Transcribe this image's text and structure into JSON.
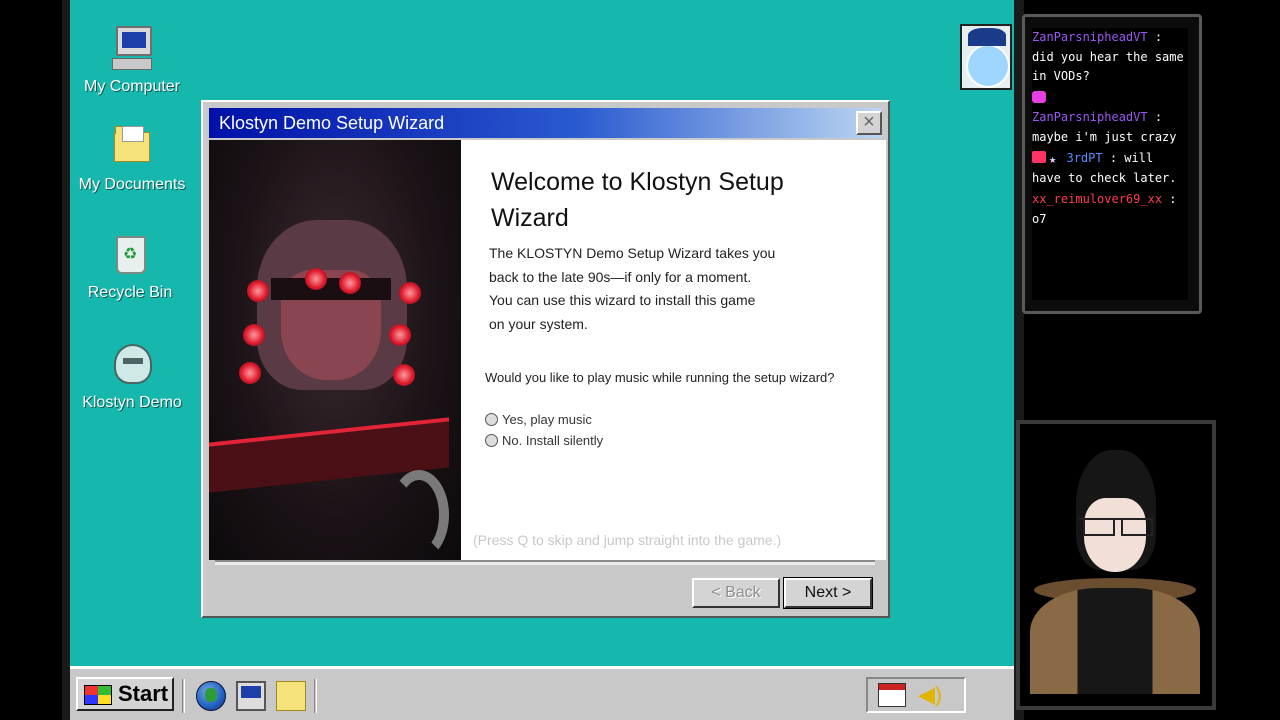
{
  "desktop": {
    "icons": [
      {
        "label": "My Computer"
      },
      {
        "label": "My Documents"
      },
      {
        "label": "Recycle Bin"
      },
      {
        "label": "Klostyn Demo"
      }
    ]
  },
  "wizard": {
    "title": "Klostyn Demo Setup Wizard",
    "heading": "Welcome to Klostyn Setup Wizard",
    "description": "The KLOSTYN Demo Setup Wizard takes you\nback to the late 90s—if only for a moment.\nYou can use this wizard to install this game\n on your system.",
    "question": "Would you like to play music while running the setup wizard?",
    "options": [
      {
        "label": "Yes, play music",
        "selected": false
      },
      {
        "label": "No. Install silently",
        "selected": false
      }
    ],
    "hint": "(Press Q to skip and jump straight into the game.)",
    "back_label": "< Back",
    "next_label": "Next >",
    "close_glyph": "×"
  },
  "taskbar": {
    "start_label": "Start",
    "quick_launch": [
      "globe-icon",
      "computer-icon",
      "folder-icon"
    ],
    "tray": [
      "calendar-icon",
      "volume-icon"
    ]
  },
  "chat": {
    "messages": [
      {
        "user": "ZanParsnipheadVT",
        "text": ": did you hear the same in VODs?",
        "user_color": "#9b59f0"
      },
      {
        "user": "ZanParsnipheadVT",
        "text": ": maybe i'm just crazy",
        "user_color": "#9b59f0"
      },
      {
        "user": "3rdPT",
        "text": ": will have to check later.",
        "user_color": "#5b8cff"
      },
      {
        "user": "xx_reimulover69_xx",
        "text": ": o7",
        "user_color": "#ff3b4d"
      }
    ]
  },
  "colors": {
    "desktop": "#16b8ad",
    "titlebar_start": "#0010a8",
    "titlebar_end": "#bcd7f2"
  }
}
